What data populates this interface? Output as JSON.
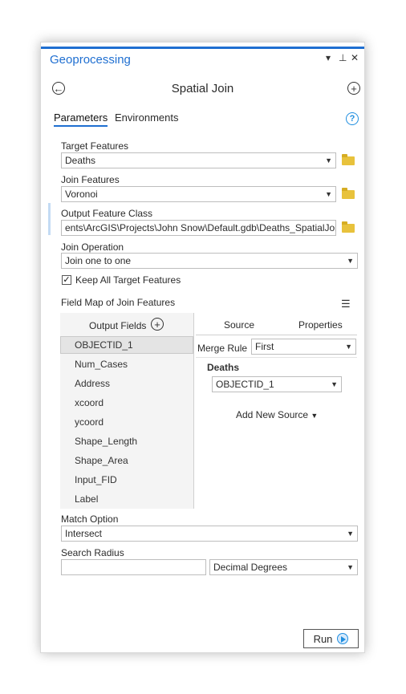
{
  "window": {
    "title": "Geoprocessing",
    "controls": {
      "dropdown": "▾",
      "pin": "⊥",
      "close": "✕"
    }
  },
  "tool": {
    "title": "Spatial Join",
    "tabs": [
      "Parameters",
      "Environments"
    ],
    "help": "?"
  },
  "params": {
    "target_features": {
      "label": "Target Features",
      "value": "Deaths"
    },
    "join_features": {
      "label": "Join Features",
      "value": "Voronoi"
    },
    "output_feature_class": {
      "label": "Output Feature Class",
      "value": "ents\\ArcGIS\\Projects\\John Snow\\Default.gdb\\Deaths_SpatialJoin"
    },
    "join_operation": {
      "label": "Join Operation",
      "value": "Join one to one"
    },
    "keep_all": {
      "label": "Keep All Target Features",
      "checked": true
    },
    "field_map_label": "Field Map of Join Features",
    "match_option": {
      "label": "Match Option",
      "value": "Intersect"
    },
    "search_radius": {
      "label": "Search Radius",
      "value": "",
      "unit": "Decimal Degrees"
    }
  },
  "field_map": {
    "output_fields_header": "Output Fields",
    "fields": [
      "OBJECTID_1",
      "Num_Cases",
      "Address",
      "xcoord",
      "ycoord",
      "Shape_Length",
      "Shape_Area",
      "Input_FID",
      "Label"
    ],
    "selected_index": 0,
    "tabs": [
      "Source",
      "Properties"
    ],
    "merge_rule_label": "Merge Rule",
    "merge_rule_value": "First",
    "source_name": "Deaths",
    "source_field": "OBJECTID_1",
    "add_new_source": "Add New Source"
  },
  "run_label": "Run",
  "colors": {
    "accent": "#1f6fd1",
    "folder": "#e8c23c"
  }
}
